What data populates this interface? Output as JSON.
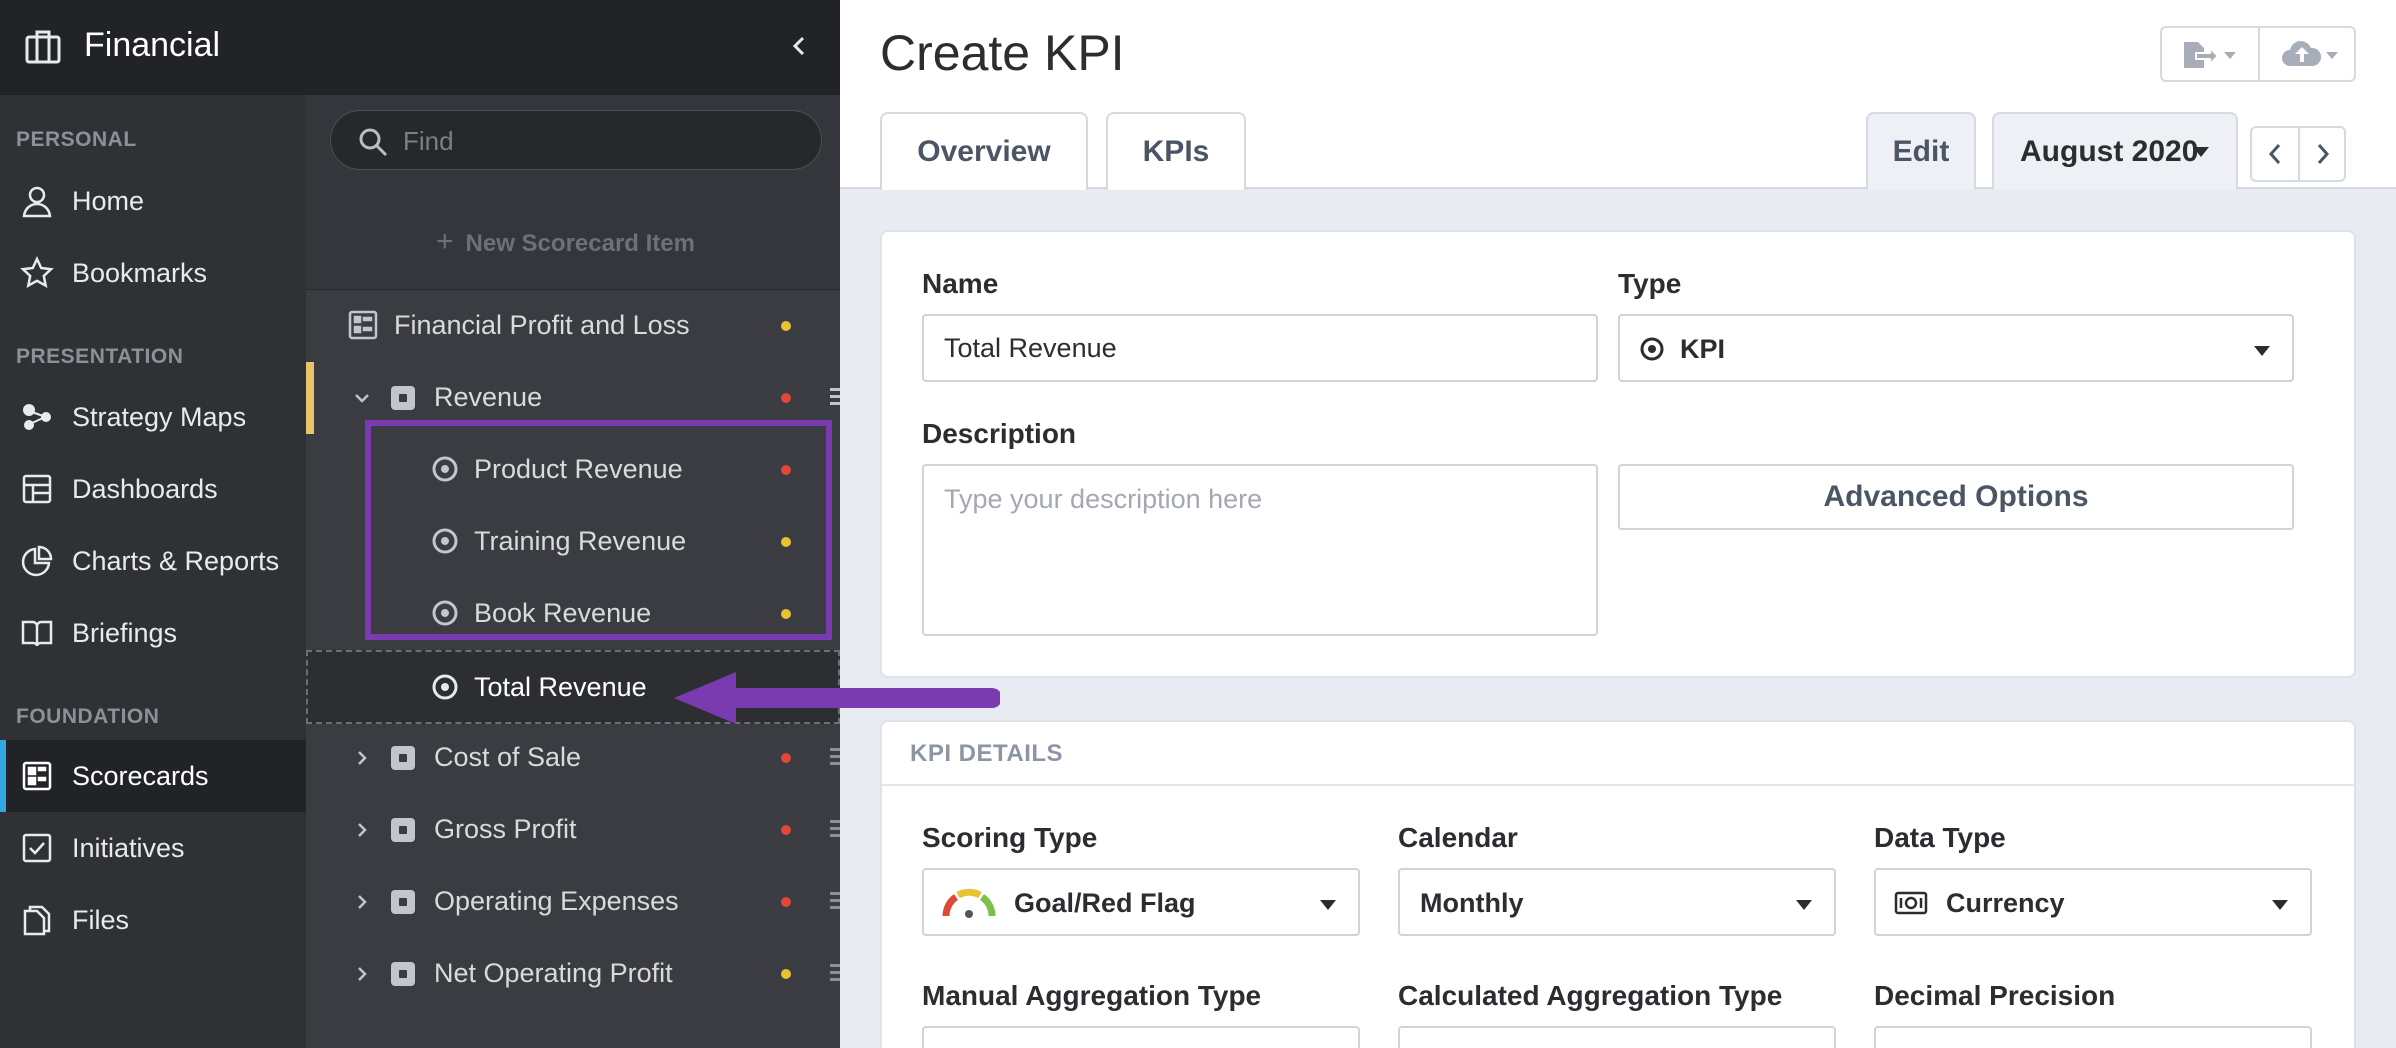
{
  "app": {
    "title": "Financial"
  },
  "nav": {
    "sections": {
      "personal": "PERSONAL",
      "presentation": "PRESENTATION",
      "foundation": "FOUNDATION"
    },
    "items": {
      "home": "Home",
      "bookmarks": "Bookmarks",
      "strategy_maps": "Strategy Maps",
      "dashboards": "Dashboards",
      "charts_reports": "Charts & Reports",
      "briefings": "Briefings",
      "scorecards": "Scorecards",
      "initiatives": "Initiatives",
      "files": "Files"
    }
  },
  "tree": {
    "search_placeholder": "Find",
    "new_item": "New Scorecard Item",
    "rows": [
      {
        "label": "Financial Profit and Loss",
        "status": "#e9c231"
      },
      {
        "label": "Revenue",
        "status": "#e0493a"
      },
      {
        "label": "Product Revenue",
        "status": "#e0493a"
      },
      {
        "label": "Training Revenue",
        "status": "#e9c231"
      },
      {
        "label": "Book Revenue",
        "status": "#e9c231"
      },
      {
        "label": "Total Revenue"
      },
      {
        "label": "Cost of Sale",
        "status": "#e0493a"
      },
      {
        "label": "Gross Profit",
        "status": "#e0493a"
      },
      {
        "label": "Operating Expenses",
        "status": "#e0493a"
      },
      {
        "label": "Net Operating Profit",
        "status": "#e9c231"
      }
    ]
  },
  "main": {
    "title": "Create KPI",
    "tabs": {
      "overview": "Overview",
      "kpis": "KPIs",
      "edit": "Edit",
      "period": "August 2020"
    },
    "form": {
      "name_label": "Name",
      "name_value": "Total Revenue",
      "type_label": "Type",
      "type_value": "KPI",
      "description_label": "Description",
      "description_placeholder": "Type your description here",
      "advanced_options": "Advanced Options"
    },
    "details": {
      "header": "KPI DETAILS",
      "scoring_type_label": "Scoring Type",
      "scoring_type_value": "Goal/Red Flag",
      "calendar_label": "Calendar",
      "calendar_value": "Monthly",
      "data_type_label": "Data Type",
      "data_type_value": "Currency",
      "manual_agg_label": "Manual Aggregation Type",
      "calc_agg_label": "Calculated Aggregation Type",
      "decimal_label": "Decimal Precision"
    }
  },
  "colors": {
    "accent": "#2fa8e0",
    "highlight": "#7a3bb0",
    "selected": "#e9c46a"
  }
}
